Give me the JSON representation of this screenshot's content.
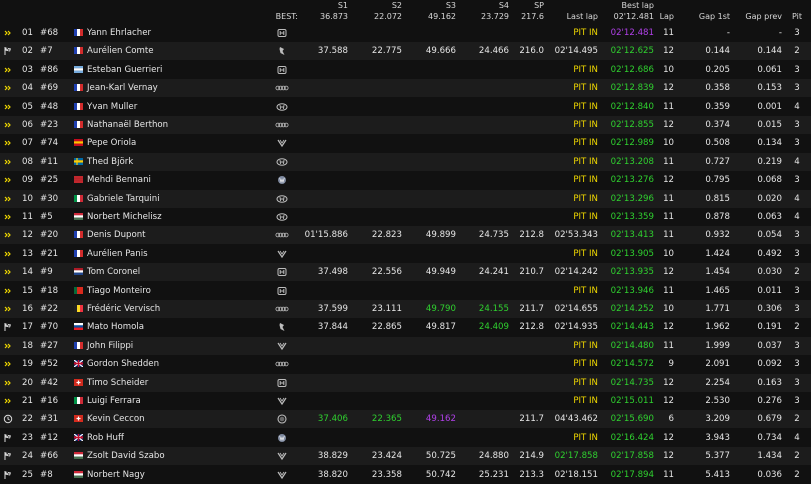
{
  "header": {
    "best_label": "BEST:",
    "s1": "S1",
    "s2": "S2",
    "s3": "S3",
    "s4": "S4",
    "sp": "SP",
    "last_lap": "Last lap",
    "best_lap_top": "Best lap",
    "lap": "Lap",
    "gap_first": "Gap 1st",
    "gap_prev": "Gap prev",
    "pit": "Pit",
    "best_s1": "36.873",
    "best_s2": "22.072",
    "best_s3": "49.162",
    "best_s4": "23.729",
    "best_sp": "217.6",
    "best_lap": "02'12.481"
  },
  "colors": {
    "green": "#2fd02f",
    "purple": "#b040e8",
    "yellow": "#f0d800",
    "white": "#e6e6e6"
  },
  "rows": [
    {
      "status": "yellow-arrows",
      "pos": "01",
      "num": "#68",
      "flag": "fr",
      "driver": "Yann Ehrlacher",
      "logo": "honda",
      "s1": "",
      "s2": "",
      "s3": "",
      "s4": "",
      "sp": "",
      "last": "PIT IN",
      "last_c": "y",
      "best": "02'12.481",
      "best_c": "p",
      "lap": "11",
      "gap1": "-",
      "gapp": "-",
      "pit": "3"
    },
    {
      "status": "chequered",
      "pos": "02",
      "num": "#7",
      "flag": "fr",
      "driver": "Aurélien Comte",
      "logo": "peugeot",
      "s1": "37.588",
      "s2": "22.775",
      "s3": "49.666",
      "s4": "24.466",
      "sp": "216.0",
      "last": "02'14.495",
      "last_c": "w",
      "best": "02'12.625",
      "best_c": "g",
      "lap": "12",
      "gap1": "0.144",
      "gapp": "0.144",
      "pit": "2"
    },
    {
      "status": "yellow-arrows",
      "pos": "03",
      "num": "#86",
      "flag": "ar",
      "driver": "Esteban Guerrieri",
      "logo": "honda",
      "s1": "",
      "s2": "",
      "s3": "",
      "s4": "",
      "sp": "",
      "last": "PIT IN",
      "last_c": "y",
      "best": "02'12.686",
      "best_c": "g",
      "lap": "10",
      "gap1": "0.205",
      "gapp": "0.061",
      "pit": "3"
    },
    {
      "status": "yellow-arrows",
      "pos": "04",
      "num": "#69",
      "flag": "fr",
      "driver": "Jean-Karl Vernay",
      "logo": "audi",
      "s1": "",
      "s2": "",
      "s3": "",
      "s4": "",
      "sp": "",
      "last": "PIT IN",
      "last_c": "y",
      "best": "02'12.839",
      "best_c": "g",
      "lap": "12",
      "gap1": "0.358",
      "gapp": "0.153",
      "pit": "3"
    },
    {
      "status": "yellow-arrows",
      "pos": "05",
      "num": "#48",
      "flag": "fr",
      "driver": "Yvan Muller",
      "logo": "hyundai",
      "s1": "",
      "s2": "",
      "s3": "",
      "s4": "",
      "sp": "",
      "last": "PIT IN",
      "last_c": "y",
      "best": "02'12.840",
      "best_c": "g",
      "lap": "11",
      "gap1": "0.359",
      "gapp": "0.001",
      "pit": "4"
    },
    {
      "status": "yellow-arrows",
      "pos": "06",
      "num": "#23",
      "flag": "fr",
      "driver": "Nathanaël Berthon",
      "logo": "audi",
      "s1": "",
      "s2": "",
      "s3": "",
      "s4": "",
      "sp": "",
      "last": "PIT IN",
      "last_c": "y",
      "best": "02'12.855",
      "best_c": "g",
      "lap": "12",
      "gap1": "0.374",
      "gapp": "0.015",
      "pit": "3"
    },
    {
      "status": "yellow-arrows",
      "pos": "07",
      "num": "#74",
      "flag": "es",
      "driver": "Pepe Oriola",
      "logo": "cupra",
      "s1": "",
      "s2": "",
      "s3": "",
      "s4": "",
      "sp": "",
      "last": "PIT IN",
      "last_c": "y",
      "best": "02'12.989",
      "best_c": "g",
      "lap": "10",
      "gap1": "0.508",
      "gapp": "0.134",
      "pit": "3"
    },
    {
      "status": "yellow-arrows",
      "pos": "08",
      "num": "#11",
      "flag": "se",
      "driver": "Thed Björk",
      "logo": "hyundai",
      "s1": "",
      "s2": "",
      "s3": "",
      "s4": "",
      "sp": "",
      "last": "PIT IN",
      "last_c": "y",
      "best": "02'13.208",
      "best_c": "g",
      "lap": "11",
      "gap1": "0.727",
      "gapp": "0.219",
      "pit": "4"
    },
    {
      "status": "yellow-arrows",
      "pos": "09",
      "num": "#25",
      "flag": "ma",
      "driver": "Mehdi Bennani",
      "logo": "vw",
      "s1": "",
      "s2": "",
      "s3": "",
      "s4": "",
      "sp": "",
      "last": "PIT IN",
      "last_c": "y",
      "best": "02'13.276",
      "best_c": "g",
      "lap": "12",
      "gap1": "0.795",
      "gapp": "0.068",
      "pit": "3"
    },
    {
      "status": "yellow-arrows",
      "pos": "10",
      "num": "#30",
      "flag": "it",
      "driver": "Gabriele Tarquini",
      "logo": "hyundai",
      "s1": "",
      "s2": "",
      "s3": "",
      "s4": "",
      "sp": "",
      "last": "PIT IN",
      "last_c": "y",
      "best": "02'13.296",
      "best_c": "g",
      "lap": "11",
      "gap1": "0.815",
      "gapp": "0.020",
      "pit": "4"
    },
    {
      "status": "yellow-arrows",
      "pos": "11",
      "num": "#5",
      "flag": "hu",
      "driver": "Norbert Michelisz",
      "logo": "hyundai",
      "s1": "",
      "s2": "",
      "s3": "",
      "s4": "",
      "sp": "",
      "last": "PIT IN",
      "last_c": "y",
      "best": "02'13.359",
      "best_c": "g",
      "lap": "11",
      "gap1": "0.878",
      "gapp": "0.063",
      "pit": "4"
    },
    {
      "status": "yellow-arrows",
      "pos": "12",
      "num": "#20",
      "flag": "fr",
      "driver": "Denis Dupont",
      "logo": "audi",
      "s1": "01'15.886",
      "s2": "22.823",
      "s3": "49.899",
      "s4": "24.735",
      "sp": "212.8",
      "last": "02'53.343",
      "last_c": "w",
      "best": "02'13.413",
      "best_c": "g",
      "lap": "11",
      "gap1": "0.932",
      "gapp": "0.054",
      "pit": "3"
    },
    {
      "status": "yellow-arrows",
      "pos": "13",
      "num": "#21",
      "flag": "fr",
      "driver": "Aurélien Panis",
      "logo": "cupra",
      "s1": "",
      "s2": "",
      "s3": "",
      "s4": "",
      "sp": "",
      "last": "PIT IN",
      "last_c": "y",
      "best": "02'13.905",
      "best_c": "g",
      "lap": "10",
      "gap1": "1.424",
      "gapp": "0.492",
      "pit": "3"
    },
    {
      "status": "yellow-arrows",
      "pos": "14",
      "num": "#9",
      "flag": "nl",
      "driver": "Tom Coronel",
      "logo": "honda",
      "s1": "37.498",
      "s2": "22.556",
      "s3": "49.949",
      "s4": "24.241",
      "sp": "210.7",
      "last": "02'14.242",
      "last_c": "w",
      "best": "02'13.935",
      "best_c": "g",
      "lap": "12",
      "gap1": "1.454",
      "gapp": "0.030",
      "pit": "2"
    },
    {
      "status": "yellow-arrows",
      "pos": "15",
      "num": "#18",
      "flag": "pt",
      "driver": "Tiago Monteiro",
      "logo": "honda",
      "s1": "",
      "s2": "",
      "s3": "",
      "s4": "",
      "sp": "",
      "last": "PIT IN",
      "last_c": "y",
      "best": "02'13.946",
      "best_c": "g",
      "lap": "11",
      "gap1": "1.465",
      "gapp": "0.011",
      "pit": "3"
    },
    {
      "status": "yellow-arrows",
      "pos": "16",
      "num": "#22",
      "flag": "be",
      "driver": "Frédéric Vervisch",
      "logo": "audi",
      "s1": "37.599",
      "s2": "23.111",
      "s3": "49.790",
      "s3_c": "g",
      "s4": "24.155",
      "s4_c": "g",
      "sp": "211.7",
      "last": "02'14.655",
      "last_c": "w",
      "best": "02'14.252",
      "best_c": "g",
      "lap": "10",
      "gap1": "1.771",
      "gapp": "0.306",
      "pit": "3"
    },
    {
      "status": "chequered",
      "pos": "17",
      "num": "#70",
      "flag": "sk",
      "driver": "Mato Homola",
      "logo": "peugeot",
      "s1": "37.844",
      "s2": "22.865",
      "s3": "49.817",
      "s4": "24.409",
      "s4_c": "g",
      "sp": "212.8",
      "last": "02'14.935",
      "last_c": "w",
      "best": "02'14.443",
      "best_c": "g",
      "lap": "12",
      "gap1": "1.962",
      "gapp": "0.191",
      "pit": "2"
    },
    {
      "status": "yellow-arrows",
      "pos": "18",
      "num": "#27",
      "flag": "fr",
      "driver": "John Filippi",
      "logo": "cupra",
      "s1": "",
      "s2": "",
      "s3": "",
      "s4": "",
      "sp": "",
      "last": "PIT IN",
      "last_c": "y",
      "best": "02'14.480",
      "best_c": "g",
      "lap": "11",
      "gap1": "1.999",
      "gapp": "0.037",
      "pit": "3"
    },
    {
      "status": "yellow-arrows",
      "pos": "19",
      "num": "#52",
      "flag": "gb",
      "driver": "Gordon Shedden",
      "logo": "audi",
      "s1": "",
      "s2": "",
      "s3": "",
      "s4": "",
      "sp": "",
      "last": "PIT IN",
      "last_c": "y",
      "best": "02'14.572",
      "best_c": "g",
      "lap": "9",
      "gap1": "2.091",
      "gapp": "0.092",
      "pit": "3"
    },
    {
      "status": "yellow-arrows",
      "pos": "20",
      "num": "#42",
      "flag": "ch",
      "driver": "Timo Scheider",
      "logo": "honda",
      "s1": "",
      "s2": "",
      "s3": "",
      "s4": "",
      "sp": "",
      "last": "PIT IN",
      "last_c": "y",
      "best": "02'14.735",
      "best_c": "g",
      "lap": "12",
      "gap1": "2.254",
      "gapp": "0.163",
      "pit": "3"
    },
    {
      "status": "yellow-arrows",
      "pos": "21",
      "num": "#16",
      "flag": "it",
      "driver": "Luigi Ferrara",
      "logo": "cupra",
      "s1": "",
      "s2": "",
      "s3": "",
      "s4": "",
      "sp": "",
      "last": "PIT IN",
      "last_c": "y",
      "best": "02'15.011",
      "best_c": "g",
      "lap": "12",
      "gap1": "2.530",
      "gapp": "0.276",
      "pit": "3"
    },
    {
      "status": "clock",
      "pos": "22",
      "num": "#31",
      "flag": "ch",
      "driver": "Kevin Ceccon",
      "logo": "alfa",
      "s1": "37.406",
      "s1_c": "g",
      "s2": "22.365",
      "s2_c": "g",
      "s3": "49.162",
      "s3_c": "p",
      "s4": "",
      "sp": "211.7",
      "last": "04'43.462",
      "last_c": "w",
      "best": "02'15.690",
      "best_c": "g",
      "lap": "6",
      "gap1": "3.209",
      "gapp": "0.679",
      "pit": "2"
    },
    {
      "status": "chequered",
      "pos": "23",
      "num": "#12",
      "flag": "gb",
      "driver": "Rob Huff",
      "logo": "vw",
      "s1": "",
      "s2": "",
      "s3": "",
      "s4": "",
      "sp": "",
      "last": "PIT IN",
      "last_c": "y",
      "best": "02'16.424",
      "best_c": "g",
      "lap": "12",
      "gap1": "3.943",
      "gapp": "0.734",
      "pit": "4"
    },
    {
      "status": "chequered",
      "pos": "24",
      "num": "#66",
      "flag": "hu",
      "driver": "Zsolt David Szabo",
      "logo": "cupra",
      "s1": "38.829",
      "s2": "23.424",
      "s3": "50.725",
      "s4": "24.880",
      "sp": "214.9",
      "last": "02'17.858",
      "last_c": "g",
      "best": "02'17.858",
      "best_c": "g",
      "lap": "12",
      "gap1": "5.377",
      "gapp": "1.434",
      "pit": "2"
    },
    {
      "status": "chequered",
      "pos": "25",
      "num": "#8",
      "flag": "hu",
      "driver": "Norbert Nagy",
      "logo": "cupra",
      "s1": "38.820",
      "s2": "23.358",
      "s3": "50.742",
      "s4": "25.231",
      "sp": "213.3",
      "last": "02'18.151",
      "last_c": "w",
      "best": "02'17.894",
      "best_c": "g",
      "lap": "11",
      "gap1": "5.413",
      "gapp": "0.036",
      "pit": "2"
    }
  ]
}
